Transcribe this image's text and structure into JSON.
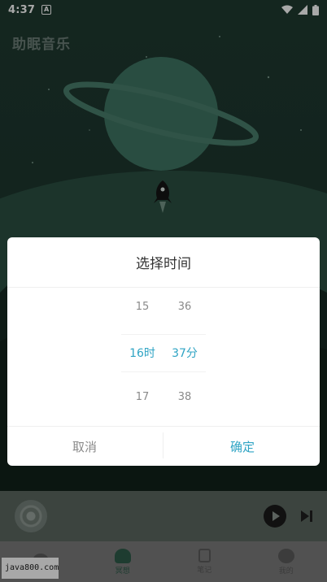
{
  "status_bar": {
    "time": "4:37",
    "badge": "A"
  },
  "app": {
    "logo_text": "助眠音乐"
  },
  "dialog": {
    "title": "选择时间",
    "hour_column": {
      "above": "15",
      "selected": "16时",
      "below": "17"
    },
    "minute_column": {
      "above": "36",
      "selected": "37分",
      "below": "38"
    },
    "cancel_label": "取消",
    "confirm_label": "确定"
  },
  "tabs": [
    {
      "label": ""
    },
    {
      "label": "冥想"
    },
    {
      "label": "笔记"
    },
    {
      "label": "我的"
    }
  ],
  "watermark": "java800.com",
  "colors": {
    "accent": "#2fa4c4",
    "scene": "#1f3a30"
  }
}
